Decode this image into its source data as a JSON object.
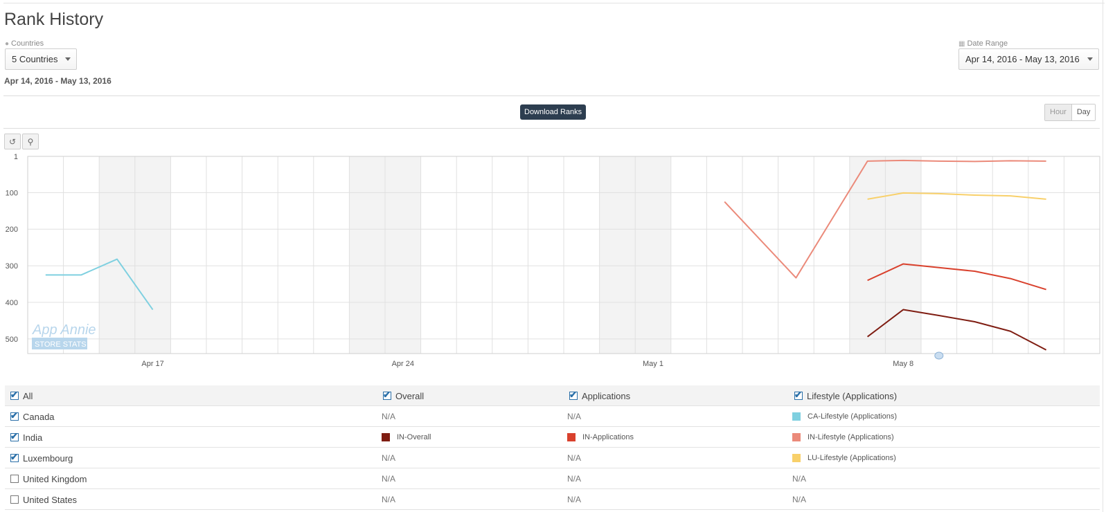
{
  "header": {
    "title": "Rank History"
  },
  "filters": {
    "countries_label": "Countries",
    "countries_value": "5 Countries",
    "date_label": "Date Range",
    "date_value": "Apr 14, 2016 - May 13, 2016"
  },
  "range_text": "Apr 14, 2016 - May 13, 2016",
  "toolbar": {
    "download_label": "Download Ranks",
    "hour_label": "Hour",
    "day_label": "Day"
  },
  "chart_data": {
    "type": "line",
    "y_reversed": true,
    "yticks": [
      1,
      100,
      200,
      300,
      400,
      500
    ],
    "x_dates": [
      "Apr 14",
      "Apr 15",
      "Apr 16",
      "Apr 17",
      "Apr 18",
      "Apr 19",
      "Apr 20",
      "Apr 21",
      "Apr 22",
      "Apr 23",
      "Apr 24",
      "Apr 25",
      "Apr 26",
      "Apr 27",
      "Apr 28",
      "Apr 29",
      "Apr 30",
      "May 1",
      "May 2",
      "May 3",
      "May 4",
      "May 5",
      "May 6",
      "May 7",
      "May 8",
      "May 9",
      "May 10",
      "May 11",
      "May 12",
      "May 13"
    ],
    "xtick_labels": [
      {
        "date": "Apr 17",
        "label": "Apr 17"
      },
      {
        "date": "Apr 24",
        "label": "Apr 24"
      },
      {
        "date": "May 1",
        "label": "May 1"
      },
      {
        "date": "May 8",
        "label": "May 8"
      }
    ],
    "shaded_dates": [
      "Apr 16",
      "Apr 17",
      "Apr 23",
      "Apr 24",
      "Apr 30",
      "May 1",
      "May 7",
      "May 8"
    ],
    "series": [
      {
        "name": "CA-Lifestyle (Applications)",
        "color": "#7fd0e0",
        "points": [
          [
            "Apr 14",
            325
          ],
          [
            "Apr 15",
            325
          ],
          [
            "Apr 16",
            282
          ],
          [
            "Apr 17",
            420
          ]
        ]
      },
      {
        "name": "IN-Lifestyle (Applications)",
        "color": "#eb8a7a",
        "points": [
          [
            "May 3",
            125
          ],
          [
            "May 5",
            333
          ],
          [
            "May 7",
            14
          ],
          [
            "May 8",
            12
          ],
          [
            "May 9",
            14
          ],
          [
            "May 10",
            15
          ],
          [
            "May 11",
            13
          ],
          [
            "May 12",
            14
          ]
        ]
      },
      {
        "name": "LU-Lifestyle (Applications)",
        "color": "#f8d06a",
        "points": [
          [
            "May 7",
            118
          ],
          [
            "May 8",
            101
          ],
          [
            "May 9",
            103
          ],
          [
            "May 10",
            107
          ],
          [
            "May 11",
            109
          ],
          [
            "May 12",
            118
          ]
        ]
      },
      {
        "name": "IN-Applications",
        "color": "#d9412d",
        "points": [
          [
            "May 7",
            340
          ],
          [
            "May 8",
            295
          ],
          [
            "May 9",
            305
          ],
          [
            "May 10",
            315
          ],
          [
            "May 11",
            335
          ],
          [
            "May 12",
            365
          ]
        ]
      },
      {
        "name": "IN-Overall",
        "color": "#7f1d12",
        "points": [
          [
            "May 7",
            494
          ],
          [
            "May 8",
            420
          ],
          [
            "May 9",
            436
          ],
          [
            "May 10",
            453
          ],
          [
            "May 11",
            479
          ],
          [
            "May 12",
            530
          ]
        ]
      }
    ],
    "watermark": {
      "line1": "App Annie",
      "line2": "STORE STATS"
    }
  },
  "table": {
    "header": {
      "all": "All",
      "overall": "Overall",
      "applications": "Applications",
      "lifestyle": "Lifestyle (Applications)"
    },
    "rows": [
      {
        "country": "Canada",
        "checked": true,
        "overall": "N/A",
        "applications": "N/A",
        "lifestyle": "CA-Lifestyle (Applications)"
      },
      {
        "country": "India",
        "checked": true,
        "overall": "IN-Overall",
        "applications": "IN-Applications",
        "lifestyle": "IN-Lifestyle (Applications)"
      },
      {
        "country": "Luxembourg",
        "checked": true,
        "overall": "N/A",
        "applications": "N/A",
        "lifestyle": "LU-Lifestyle (Applications)"
      },
      {
        "country": "United Kingdom",
        "checked": false,
        "overall": "N/A",
        "applications": "N/A",
        "lifestyle": "N/A"
      },
      {
        "country": "United States",
        "checked": false,
        "overall": "N/A",
        "applications": "N/A",
        "lifestyle": "N/A"
      }
    ],
    "colors": {
      "in_overall": "#7f1d12",
      "in_applications": "#d9412d",
      "ca_lifestyle": "#7fd0e0",
      "in_lifestyle": "#eb8a7a",
      "lu_lifestyle": "#f8d06a"
    }
  }
}
